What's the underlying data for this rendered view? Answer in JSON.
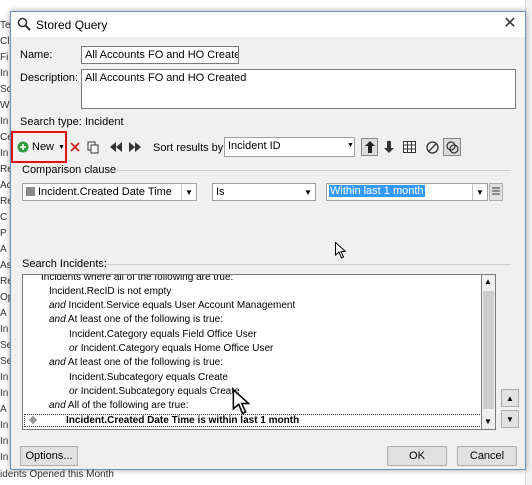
{
  "background": {
    "left_fragments": [
      "Te",
      "Cl",
      "Fi",
      "In",
      "Sc",
      "W",
      "In",
      "Ce",
      "In",
      "Re",
      "Ac",
      "Re",
      "C",
      "P",
      "A",
      "As",
      "Re",
      "Op",
      "A",
      "In",
      "Se",
      "Se",
      "In",
      "In",
      "A",
      "In",
      "In",
      "In"
    ],
    "bottom_text": "idents Opened this Month"
  },
  "dialog": {
    "title": "Stored Query",
    "close_glyph": "✕",
    "name_label": "Name:",
    "name_value": "All Accounts FO and HO Created",
    "description_label": "Description:",
    "description_value": "All Accounts FO and HO Created",
    "search_type_label": "Search type:",
    "search_type_value": "Incident",
    "toolbar": {
      "new_label": "New",
      "sort_label": "Sort results by:",
      "sort_value": "Incident ID"
    },
    "comparison_clause_label": "Comparison clause",
    "clause": {
      "field": "Incident.Created Date Time",
      "operator": "Is",
      "value": "Within last 1 month"
    },
    "search_incidents_label": "Search Incidents:",
    "tree": [
      {
        "prefix": "",
        "text": "Incidents where all of the following are true:"
      },
      {
        "prefix": "",
        "text": "Incident.RecID is not empty"
      },
      {
        "prefix": "and",
        "text": "Incident.Service equals User Account Management"
      },
      {
        "prefix": "and",
        "text": "At least one of the following is true:"
      },
      {
        "prefix": "",
        "text": "Incident.Category equals Field Office User"
      },
      {
        "prefix": "or",
        "text": "Incident.Category equals Home Office User"
      },
      {
        "prefix": "and",
        "text": "At least one of the following is true:"
      },
      {
        "prefix": "",
        "text": "Incident.Subcategory equals Create"
      },
      {
        "prefix": "or",
        "text": "Incident.Subcategory equals Create"
      },
      {
        "prefix": "and",
        "text": "All of the following are true:"
      },
      {
        "prefix": "",
        "text": "Incident.Created Date Time is within last 1 month"
      }
    ],
    "options_button": "Options...",
    "ok_button": "OK",
    "cancel_button": "Cancel"
  },
  "colors": {
    "selection": "#3399ff",
    "highlight_box": "#e01010",
    "new_icon": "#2e9a3a",
    "delete_icon": "#d02020"
  }
}
